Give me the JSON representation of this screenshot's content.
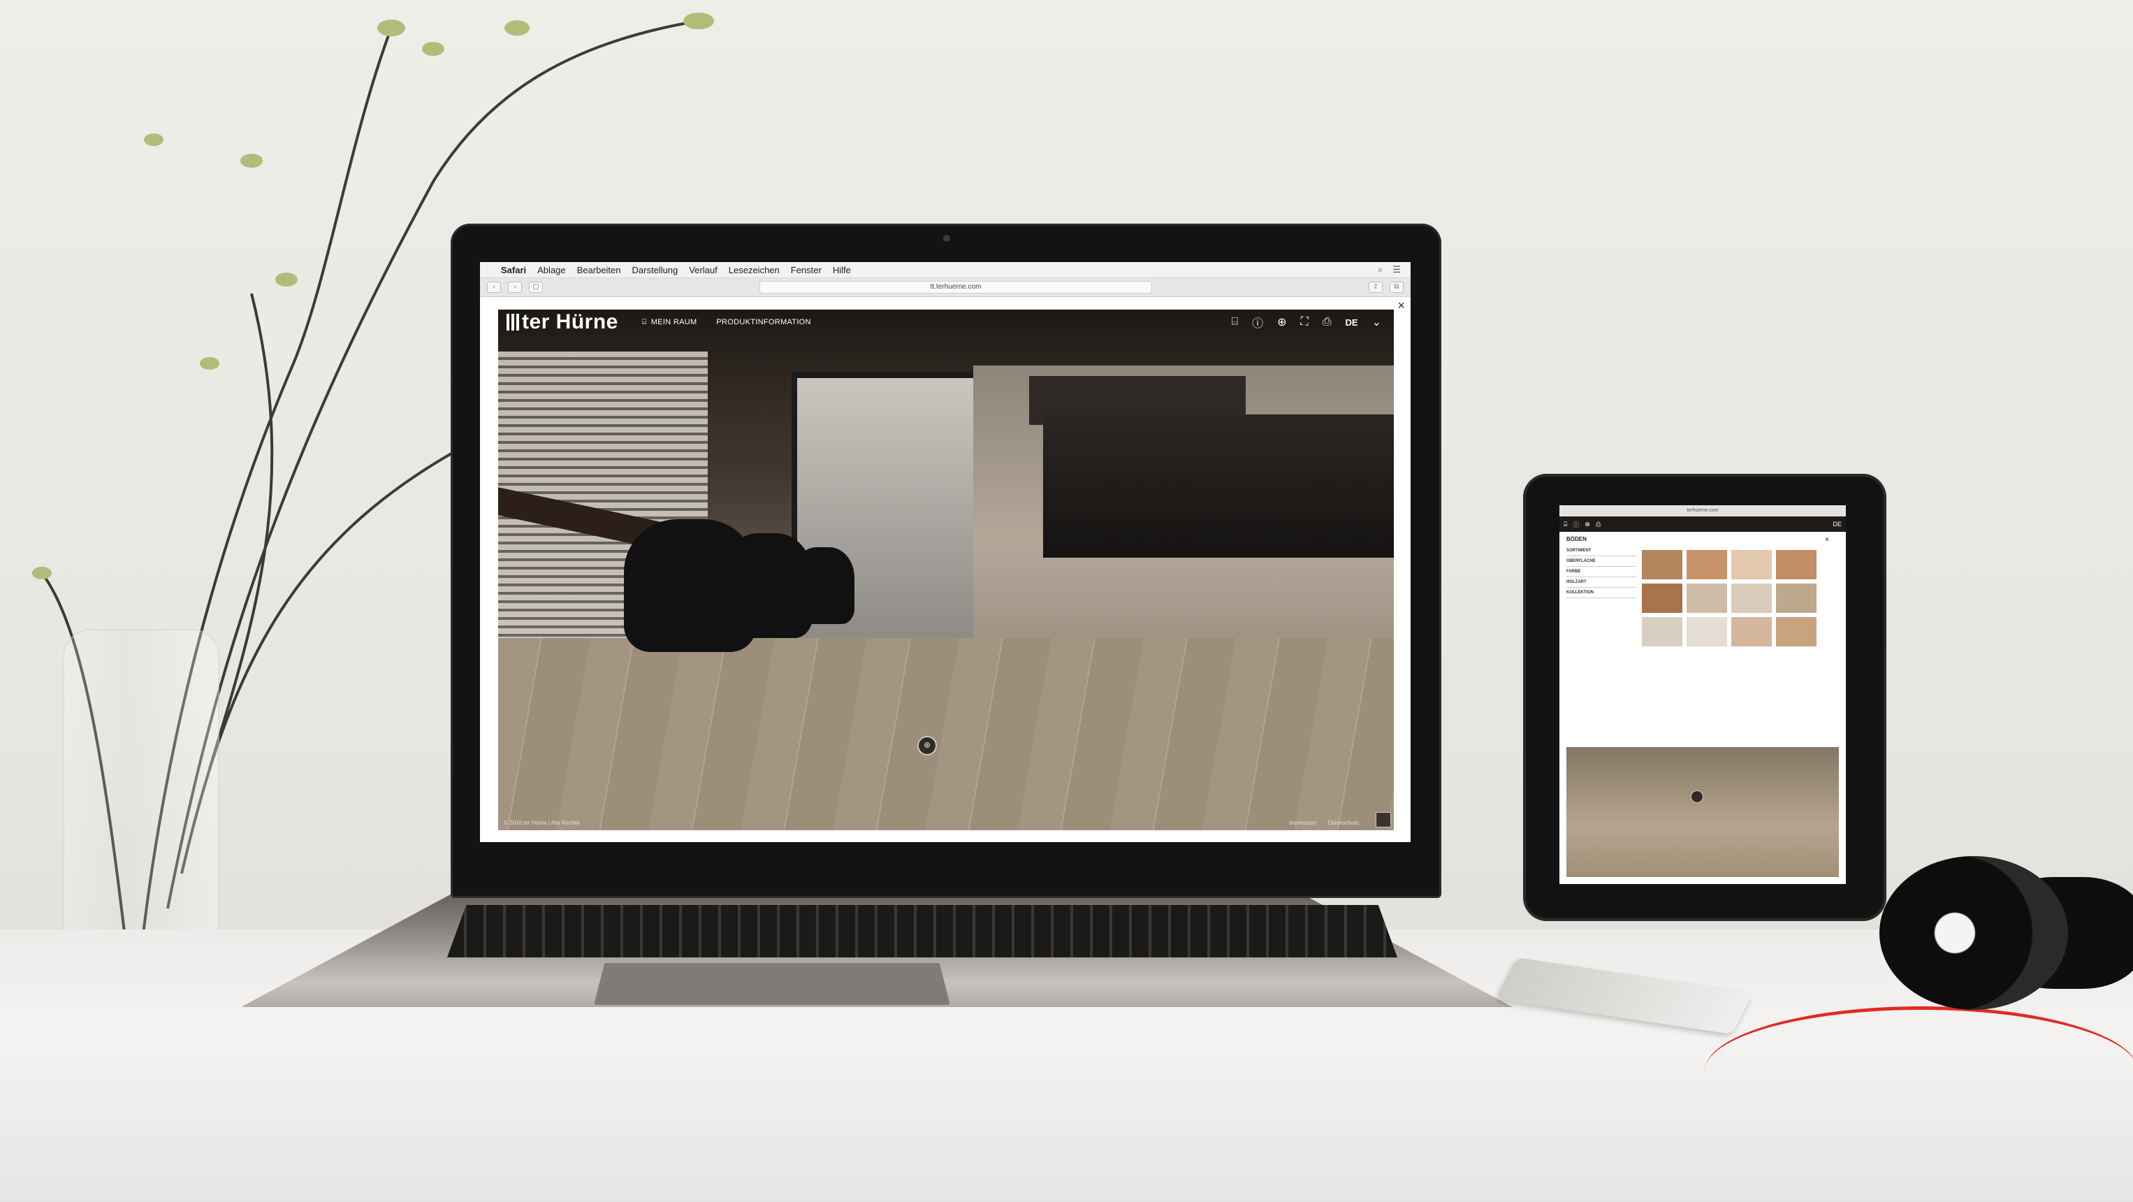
{
  "mac_menubar": {
    "items": [
      "Safari",
      "Ablage",
      "Bearbeiten",
      "Darstellung",
      "Verlauf",
      "Lesezeichen",
      "Fenster",
      "Hilfe"
    ]
  },
  "browser": {
    "url": "tt.terhuerne.com"
  },
  "app": {
    "logo_text": "ter Hürne",
    "nav": [
      "MEIN RAUM",
      "PRODUKTINFORMATION"
    ],
    "language": "DE",
    "close_glyph": "×",
    "center_badge": "⊕",
    "footer_left": "© 2016 ter Hürne | Alle Rechte",
    "footer_right": [
      "Impressum",
      "Datenschutz"
    ]
  },
  "tablet": {
    "url": "terhuerne.com",
    "panel_title": "BÖDEN",
    "filters": [
      {
        "label": "SORTIMENT",
        "value": ""
      },
      {
        "label": "OBERFLÄCHE",
        "value": ""
      },
      {
        "label": "FARBE",
        "value": ""
      },
      {
        "label": "HOLZART",
        "value": ""
      },
      {
        "label": "KOLLEKTION",
        "value": ""
      }
    ],
    "language": "DE"
  },
  "colors": {
    "brand_dark": "#1e1b18",
    "accent_red_cable": "#e02b20",
    "page_bg": "#e9e7e2"
  },
  "icons": [
    "apple-icon",
    "camera-icon",
    "info-icon",
    "zoom-icon",
    "fullscreen-icon",
    "print-icon",
    "chevron-down-icon",
    "close-icon"
  ]
}
